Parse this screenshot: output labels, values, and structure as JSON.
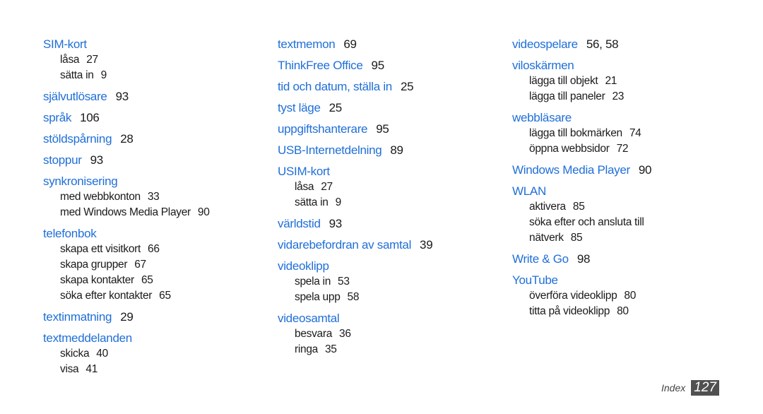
{
  "columns": [
    {
      "entries": [
        {
          "term": "SIM-kort",
          "pages": "",
          "subs": [
            {
              "term": "låsa",
              "pages": "27"
            },
            {
              "term": "sätta in",
              "pages": "9"
            }
          ]
        },
        {
          "term": "självutlösare",
          "pages": "93",
          "subs": []
        },
        {
          "term": "språk",
          "pages": "106",
          "subs": []
        },
        {
          "term": "stöldspårning",
          "pages": "28",
          "subs": []
        },
        {
          "term": "stoppur",
          "pages": "93",
          "subs": []
        },
        {
          "term": "synkronisering",
          "pages": "",
          "subs": [
            {
              "term": "med webbkonton",
              "pages": "33"
            },
            {
              "term": "med Windows Media Player",
              "pages": "90"
            }
          ]
        },
        {
          "term": "telefonbok",
          "pages": "",
          "subs": [
            {
              "term": "skapa ett visitkort",
              "pages": "66"
            },
            {
              "term": "skapa grupper",
              "pages": "67"
            },
            {
              "term": "skapa kontakter",
              "pages": "65"
            },
            {
              "term": "söka efter kontakter",
              "pages": "65"
            }
          ]
        },
        {
          "term": "textinmatning",
          "pages": "29",
          "subs": []
        },
        {
          "term": "textmeddelanden",
          "pages": "",
          "subs": [
            {
              "term": "skicka",
              "pages": "40"
            },
            {
              "term": "visa",
              "pages": "41"
            }
          ]
        }
      ]
    },
    {
      "entries": [
        {
          "term": "textmemon",
          "pages": "69",
          "subs": []
        },
        {
          "term": "ThinkFree Office",
          "pages": "95",
          "subs": []
        },
        {
          "term": "tid och datum, ställa in",
          "pages": "25",
          "subs": []
        },
        {
          "term": "tyst läge",
          "pages": "25",
          "subs": []
        },
        {
          "term": "uppgiftshanterare",
          "pages": "95",
          "subs": []
        },
        {
          "term": "USB-Internetdelning",
          "pages": "89",
          "subs": []
        },
        {
          "term": "USIM-kort",
          "pages": "",
          "subs": [
            {
              "term": "låsa",
              "pages": "27"
            },
            {
              "term": "sätta in",
              "pages": "9"
            }
          ]
        },
        {
          "term": "världstid",
          "pages": "93",
          "subs": []
        },
        {
          "term": "vidarebefordran av samtal",
          "pages": "39",
          "subs": []
        },
        {
          "term": "videoklipp",
          "pages": "",
          "subs": [
            {
              "term": "spela in",
              "pages": "53"
            },
            {
              "term": "spela upp",
              "pages": "58"
            }
          ]
        },
        {
          "term": "videosamtal",
          "pages": "",
          "subs": [
            {
              "term": "besvara",
              "pages": "36"
            },
            {
              "term": "ringa",
              "pages": "35"
            }
          ]
        }
      ]
    },
    {
      "entries": [
        {
          "term": "videospelare",
          "pages": "56, 58",
          "subs": []
        },
        {
          "term": "viloskärmen",
          "pages": "",
          "subs": [
            {
              "term": "lägga till objekt",
              "pages": "21"
            },
            {
              "term": "lägga till paneler",
              "pages": "23"
            }
          ]
        },
        {
          "term": "webbläsare",
          "pages": "",
          "subs": [
            {
              "term": "lägga till bokmärken",
              "pages": "74"
            },
            {
              "term": "öppna webbsidor",
              "pages": "72"
            }
          ]
        },
        {
          "term": "Windows Media Player",
          "pages": "90",
          "subs": []
        },
        {
          "term": "WLAN",
          "pages": "",
          "subs": [
            {
              "term": "aktivera",
              "pages": "85"
            },
            {
              "term": "söka efter och ansluta till",
              "pages": ""
            },
            {
              "term": "nätverk",
              "pages": "85"
            }
          ]
        },
        {
          "term": "Write & Go",
          "pages": "98",
          "subs": []
        },
        {
          "term": "YouTube",
          "pages": "",
          "subs": [
            {
              "term": "överföra videoklipp",
              "pages": "80"
            },
            {
              "term": "titta på videoklipp",
              "pages": "80"
            }
          ]
        }
      ]
    }
  ],
  "footer": {
    "label": "Index",
    "page": "127"
  },
  "colors": {
    "term": "#1f6fd8",
    "text": "#1a1a1a",
    "page_badge": "#505050"
  }
}
